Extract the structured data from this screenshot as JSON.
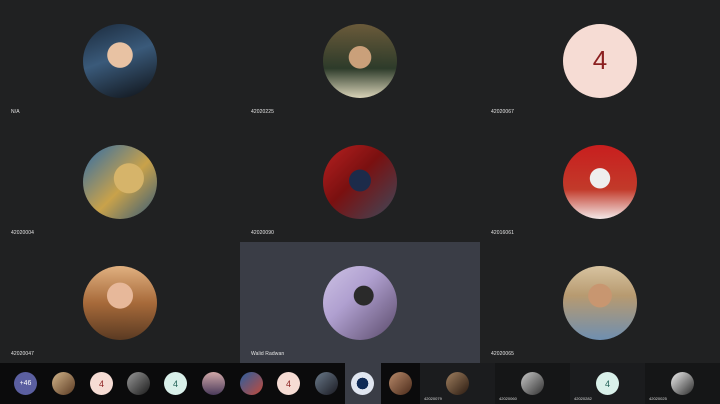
{
  "participants": [
    {
      "name": "N/A"
    },
    {
      "name": "42020225"
    },
    {
      "name": "42020067",
      "initial": "4"
    },
    {
      "name": "42020004"
    },
    {
      "name": "42020090"
    },
    {
      "name": "42016061"
    },
    {
      "name": "42020047"
    },
    {
      "name": "Walid Radwan"
    },
    {
      "name": "42020065"
    }
  ],
  "strip": {
    "more_count": "+46",
    "initials": [
      "4",
      "4",
      "4",
      "4"
    ],
    "tiles": [
      {
        "name": "42020079"
      },
      {
        "name": "42020060"
      },
      {
        "name": "42020282"
      },
      {
        "name": "42020025"
      }
    ]
  },
  "colors": {
    "tile_bg": "#202122",
    "active_tile_bg": "#3a3d46",
    "initial_avatar_bg": "#f6dcd4",
    "initial_avatar_text": "#8b1f1f",
    "more_bubble_bg": "#5b5fa0"
  }
}
